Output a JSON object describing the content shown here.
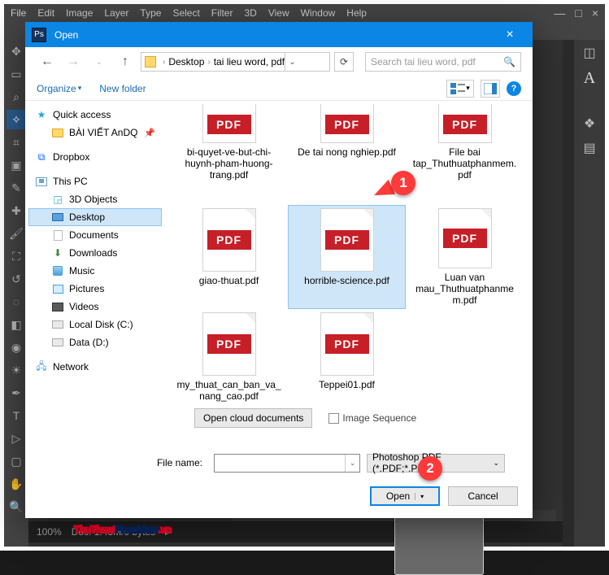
{
  "ps": {
    "menubar": [
      "File",
      "Edit",
      "Image",
      "Layer",
      "Type",
      "Select",
      "Filter",
      "3D",
      "View",
      "Window",
      "Help"
    ],
    "win_min": "—",
    "win_max": "□",
    "win_close": "×",
    "right_icons": {
      "A": "A",
      "sw": "◫",
      "layers": "❖",
      "panel": "▤"
    },
    "status_zoom": "100%",
    "status_doc": "Doc: 1.43M/0 bytes",
    "status_arrow": "▸"
  },
  "dlg": {
    "title": "Open",
    "close": "×",
    "nav": {
      "back": "←",
      "fwd": "→",
      "up": "↑"
    },
    "crumb": {
      "root": "",
      "desktop": "Desktop",
      "folder": "tai lieu word, pdf",
      "sep": "›",
      "drop": "⌄"
    },
    "refresh": "⟳",
    "search": {
      "placeholder": "Search tai lieu word, pdf",
      "icon": "🔍"
    },
    "organize": {
      "label": "Organize",
      "newfolder": "New folder"
    },
    "help": "?"
  },
  "sidebar": {
    "quick": "Quick access",
    "folder1": "BÀI VIẾT AnDQ",
    "dropbox": "Dropbox",
    "thispc": "This PC",
    "items": {
      "obj3d": "3D Objects",
      "desktop": "Desktop",
      "documents": "Documents",
      "downloads": "Downloads",
      "music": "Music",
      "pictures": "Pictures",
      "videos": "Videos",
      "diskc": "Local Disk (C:)",
      "diskd": "Data (D:)"
    },
    "network": "Network"
  },
  "files": [
    {
      "name": "bi-quyet-ve-but-chi-huynh-pham-huong-trang.pdf",
      "partial": true
    },
    {
      "name": "De tai nong nghiep.pdf",
      "partial": true
    },
    {
      "name": "File bai tap_Thuthuatphanmem.pdf",
      "partial": true
    },
    {
      "name": "giao-thuat.pdf"
    },
    {
      "name": "horrible-science.pdf",
      "selected": true
    },
    {
      "name": "Luan van mau_Thuthuatphanmem.pdf"
    },
    {
      "name": "my_thuat_can_ban_va_nang_cao.pdf"
    },
    {
      "name": "Teppei01.pdf"
    }
  ],
  "badge": "PDF",
  "cloud_btn": "Open cloud documents",
  "image_seq": "Image Sequence",
  "filename_label": "File name:",
  "filetype": "Photoshop PDF (*.PDF;*.PDP)",
  "open_btn": "Open",
  "cancel_btn": "Cancel",
  "markers": {
    "m1": "1",
    "m2": "2"
  },
  "watermark": {
    "a": "ThuThuat",
    "b": "PhanMem",
    "c": ".vn"
  }
}
